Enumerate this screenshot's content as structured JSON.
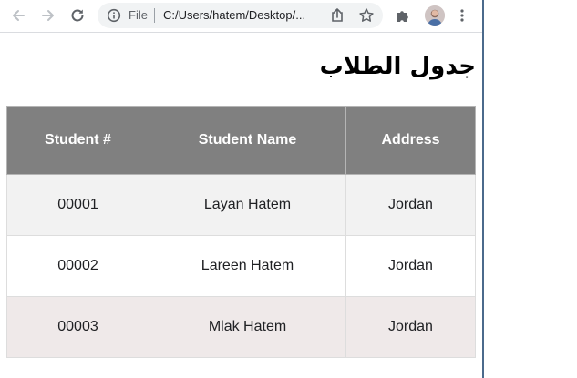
{
  "browser": {
    "file_label": "File",
    "url": "C:/Users/hatem/Desktop/...",
    "icons": {
      "back": "back-arrow-icon",
      "forward": "forward-arrow-icon",
      "reload": "reload-icon",
      "info": "info-icon",
      "share": "share-icon",
      "bookmark": "star-icon",
      "extensions": "puzzle-icon",
      "profile": "avatar",
      "menu": "kebab-menu-icon"
    }
  },
  "page": {
    "title": "جدول الطلاب",
    "table": {
      "headers": [
        "Student #",
        "Student Name",
        "Address"
      ],
      "rows": [
        [
          "00001",
          "Layan Hatem",
          "Jordan"
        ],
        [
          "00002",
          "Lareen Hatem",
          "Jordan"
        ],
        [
          "00003",
          "Mlak Hatem",
          "Jordan"
        ]
      ]
    }
  },
  "colors": {
    "header_bg": "#808080",
    "header_text": "#ffffff",
    "row_1_bg": "#f2f2f2",
    "row_2_bg": "#ffffff",
    "row_3_bg": "#efe9e9",
    "window_border": "#4b6a8c"
  }
}
